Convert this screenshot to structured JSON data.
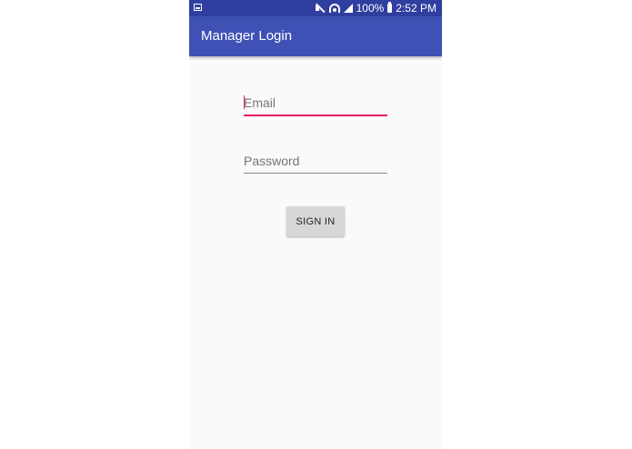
{
  "status_bar": {
    "battery_percent": "100%",
    "time": "2:52 PM",
    "icons": [
      "image-notification-icon",
      "mute-icon",
      "wifi-icon",
      "signal-icon",
      "battery-icon"
    ]
  },
  "app_bar": {
    "title": "Manager Login",
    "color": "#3f51b5",
    "status_color": "#303f9f"
  },
  "form": {
    "email": {
      "value": "",
      "placeholder": "Email",
      "accent": "#e91e63"
    },
    "password": {
      "value": "",
      "placeholder": "Password"
    },
    "sign_in_label": "SIGN IN"
  }
}
